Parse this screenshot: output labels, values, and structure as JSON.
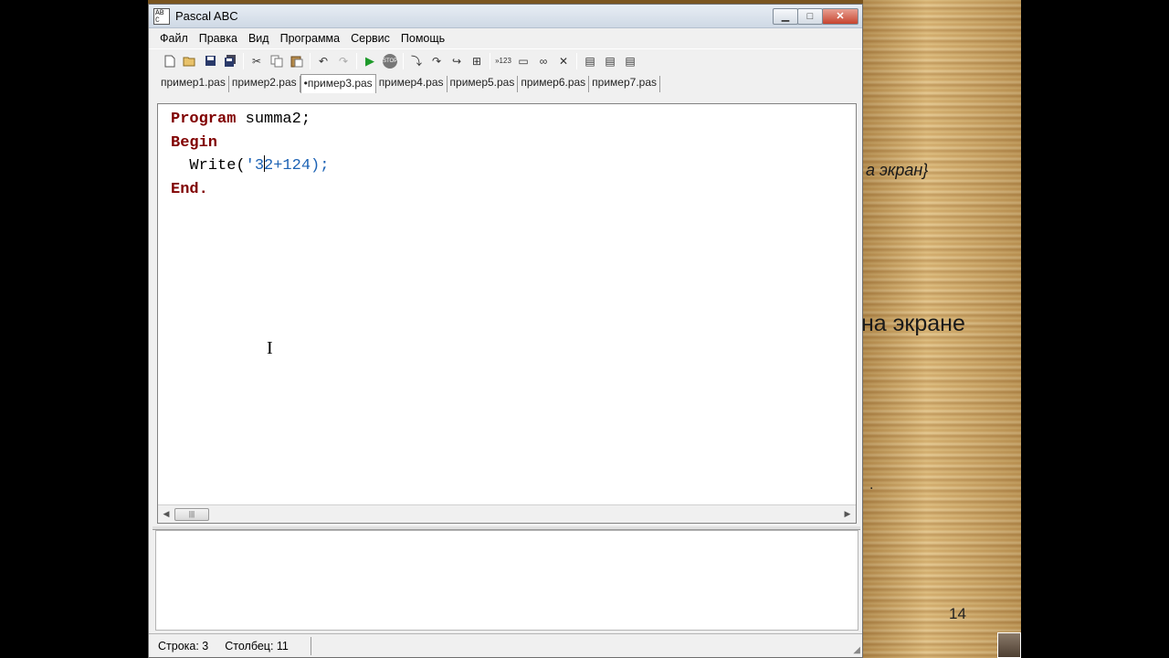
{
  "window": {
    "title": "Pascal ABC",
    "controls": {
      "minimize": "▁",
      "maximize": "□",
      "close": "✕"
    }
  },
  "menu": [
    "Файл",
    "Правка",
    "Вид",
    "Программа",
    "Сервис",
    "Помощь"
  ],
  "toolbar": {
    "icons": [
      "new-file-icon",
      "open-folder-icon",
      "save-icon",
      "save-all-icon",
      "cut-icon",
      "copy-icon",
      "paste-icon",
      "undo-icon",
      "redo-icon",
      "run-icon",
      "stop-icon",
      "step-into-icon",
      "step-over-icon",
      "step-out-icon",
      "add-watch-icon",
      "line-numbers-icon",
      "window-icon",
      "debug-icon",
      "close-icon",
      "compile-icon",
      "format-icon",
      "settings-icon"
    ],
    "line_numbers_label": "»123"
  },
  "tabs": [
    {
      "label": "пример1.pas",
      "active": false
    },
    {
      "label": "пример2.pas",
      "active": false
    },
    {
      "label": "•пример3.pas",
      "active": true
    },
    {
      "label": "пример4.pas",
      "active": false
    },
    {
      "label": "пример5.pas",
      "active": false
    },
    {
      "label": "пример6.pas",
      "active": false
    },
    {
      "label": "пример7.pas",
      "active": false
    }
  ],
  "code": {
    "line1": {
      "kw": "Program",
      "rest": " summa2;"
    },
    "line2": {
      "kw": "Begin"
    },
    "line3": {
      "indent": "  ",
      "func": "Write(",
      "str_before_caret": "'3",
      "str_after_caret": "2+124)",
      "tail": ";"
    },
    "line4": {
      "kw": "End."
    }
  },
  "status": {
    "row": "Строка: 3",
    "col": "Столбец: 11"
  },
  "slide": {
    "text1": "а экран}",
    "text2": "на экране",
    "text3": ".",
    "page_number": "14"
  },
  "colors": {
    "keyword": "#800000",
    "string": "#1d63b5",
    "titlebar": "#cfd9e5",
    "close_button": "#c7442f"
  }
}
